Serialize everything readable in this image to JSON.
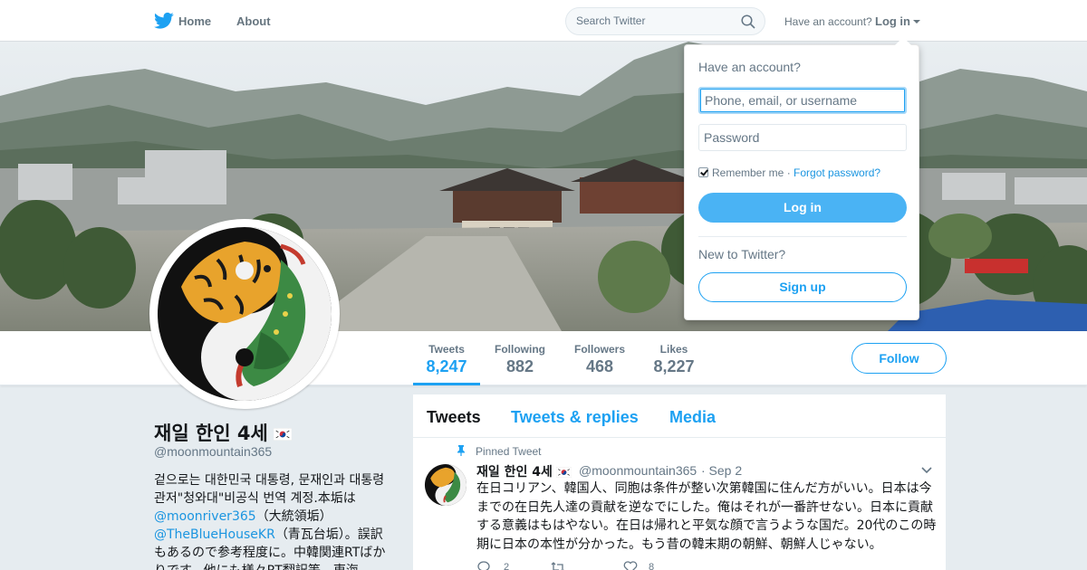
{
  "nav": {
    "home_label": "Home",
    "about_label": "About",
    "search_placeholder": "Search Twitter",
    "have_account_label": "Have an account?",
    "login_label": "Log in"
  },
  "stats": [
    {
      "label": "Tweets",
      "value": "8,247"
    },
    {
      "label": "Following",
      "value": "882"
    },
    {
      "label": "Followers",
      "value": "468"
    },
    {
      "label": "Likes",
      "value": "8,227"
    }
  ],
  "follow_label": "Follow",
  "profile": {
    "name": "재일 한인 4세",
    "handle": "@moonmountain365",
    "bio_line1": "겉으로는 대한민국 대통령, 문재인과 대통령 관저\"청와대\"비공식 번역 계정.本垢は",
    "bio_mention1": "@moonriver365",
    "bio_line2": "（大統領垢）",
    "bio_mention2": "@TheBlueHouseKR",
    "bio_line3": "（青瓦台垢）。誤訳もあるので参考程度に。中韓関連RTばかりです。他にも様々RT翻訳等。東海"
  },
  "timeline": {
    "tabs": [
      "Tweets",
      "Tweets & replies",
      "Media"
    ],
    "pinned_label": "Pinned Tweet",
    "tweet": {
      "name": "재일 한인 4세",
      "handle": "@moonmountain365",
      "time": "· Sep 2",
      "text": "在日コリアン、韓国人、同胞は条件が整い次第韓国に住んだ方がいい。日本は今までの在日先人達の貢献を逆なでにした。俺はそれが一番許せない。日本に貢献する意義はもはやない。在日は帰れと平気な顔で言うような国だ。20代のこの時期に日本の本性が分かった。もう昔の韓末期の朝鮮、朝鮮人じゃない。",
      "reply_count": "2",
      "like_count": "8"
    }
  },
  "login_dropdown": {
    "heading": "Have an account?",
    "username_placeholder": "Phone, email, or username",
    "password_placeholder": "Password",
    "remember_label": "Remember me",
    "separator": " · ",
    "forgot_label": "Forgot password?",
    "login_button": "Log in",
    "new_label": "New to Twitter?",
    "signup_button": "Sign up"
  },
  "colors": {
    "accent": "#1da1f2",
    "background": "#e6ecf0",
    "login_button": "#4ab3f4"
  },
  "icons": [
    "twitter-bird-icon",
    "search-icon",
    "caret-down-icon",
    "pin-icon",
    "korean-flag-icon",
    "reply-icon",
    "retweet-icon",
    "like-icon",
    "chevron-down-icon"
  ]
}
